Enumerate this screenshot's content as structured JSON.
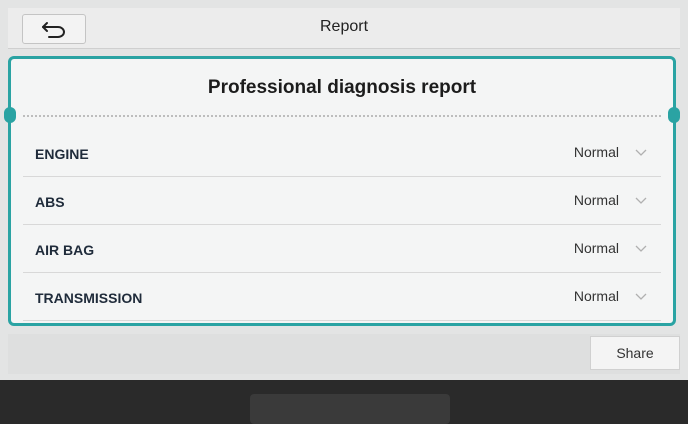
{
  "header": {
    "title": "Report",
    "back_icon": "back-arrow-icon"
  },
  "report": {
    "heading": "Professional diagnosis report",
    "rows": [
      {
        "label": "ENGINE",
        "status": "Normal"
      },
      {
        "label": "ABS",
        "status": "Normal"
      },
      {
        "label": "AIR BAG",
        "status": "Normal"
      },
      {
        "label": "TRANSMISSION",
        "status": "Normal"
      }
    ]
  },
  "footer": {
    "share_label": "Share"
  },
  "colors": {
    "accent": "#2aa3a3",
    "background": "#e3e4e4"
  }
}
